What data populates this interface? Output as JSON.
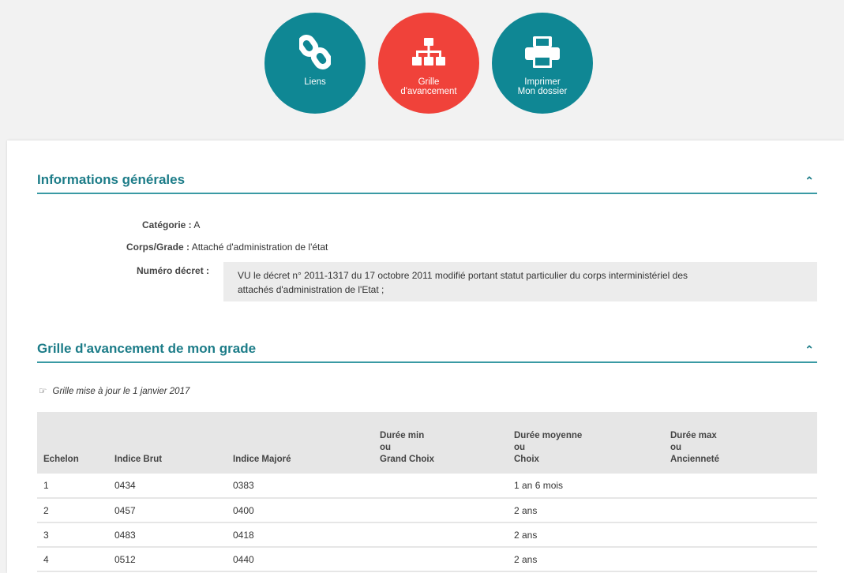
{
  "actions": {
    "links_label": "Liens",
    "grid_label_line1": "Grille",
    "grid_label_line2": "d'avancement",
    "print_label_line1": "Imprimer",
    "print_label_line2": "Mon dossier"
  },
  "colors": {
    "teal": "#0f8794",
    "red": "#f0423a",
    "section_title": "#1c7c88"
  },
  "general_info": {
    "title": "Informations générales",
    "category_label": "Catégorie :",
    "category_value": "A",
    "corps_label": "Corps/Grade :",
    "corps_value": "Attaché d'administration de l'état",
    "decree_label": "Numéro décret :",
    "decree_line1": "VU le décret n° 2011-1317 du 17 octobre 2011 modifié portant statut particulier du corps interministériel des",
    "decree_line2": "attachés d'administration de l'Etat ;"
  },
  "grid_section": {
    "title": "Grille d'avancement de mon grade",
    "note": "Grille mise à jour le 1 janvier 2017",
    "headers": {
      "echelon": "Echelon",
      "indice_brut": "Indice Brut",
      "indice_majore": "Indice Majoré",
      "min_1": "Durée min",
      "min_2": "ou",
      "min_3": "Grand Choix",
      "moy_1": "Durée moyenne",
      "moy_2": "ou",
      "moy_3": "Choix",
      "max_1": "Durée max",
      "max_2": "ou",
      "max_3": "Ancienneté"
    },
    "rows": [
      {
        "echelon": "1",
        "brut": "0434",
        "majore": "0383",
        "min": "",
        "moy": "1 an 6 mois",
        "max": ""
      },
      {
        "echelon": "2",
        "brut": "0457",
        "majore": "0400",
        "min": "",
        "moy": "2 ans",
        "max": ""
      },
      {
        "echelon": "3",
        "brut": "0483",
        "majore": "0418",
        "min": "",
        "moy": "2 ans",
        "max": ""
      },
      {
        "echelon": "4",
        "brut": "0512",
        "majore": "0440",
        "min": "",
        "moy": "2 ans",
        "max": ""
      }
    ]
  }
}
